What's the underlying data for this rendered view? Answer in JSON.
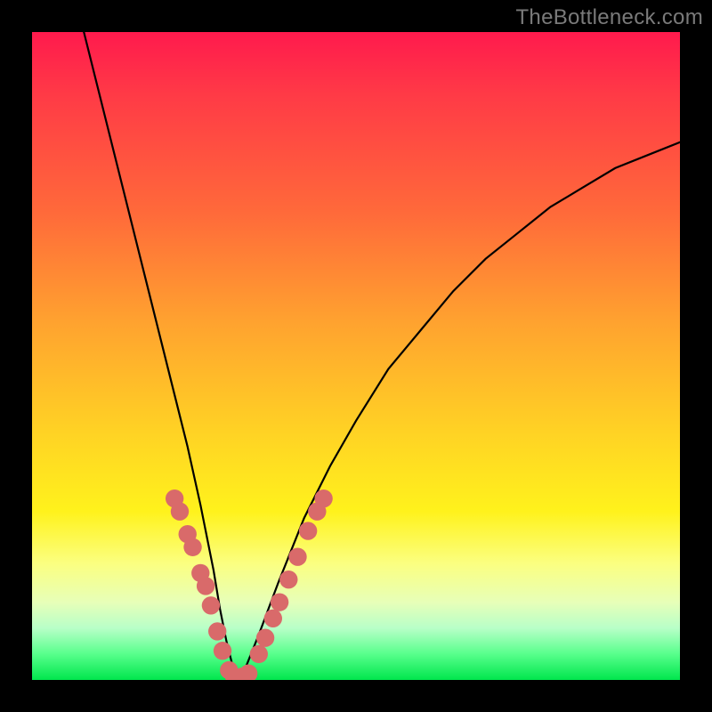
{
  "watermark": {
    "text": "TheBottleneck.com"
  },
  "chart_data": {
    "type": "line",
    "title": "",
    "xlabel": "",
    "ylabel": "",
    "xlim": [
      0,
      100
    ],
    "ylim": [
      0,
      100
    ],
    "grid": false,
    "legend": false,
    "background_gradient": {
      "direction": "vertical",
      "stops": [
        {
          "pos": 0.0,
          "color": "#ff1a4d"
        },
        {
          "pos": 0.28,
          "color": "#ff6a3a"
        },
        {
          "pos": 0.62,
          "color": "#ffd324"
        },
        {
          "pos": 0.82,
          "color": "#fbff80"
        },
        {
          "pos": 0.92,
          "color": "#b8ffc8"
        },
        {
          "pos": 1.0,
          "color": "#00e64d"
        }
      ]
    },
    "series": [
      {
        "name": "bottleneck-curve",
        "color": "#000000",
        "x": [
          8,
          10,
          12,
          14,
          16,
          18,
          20,
          22,
          24,
          26,
          28,
          29,
          30,
          31,
          32,
          33,
          35,
          38,
          42,
          46,
          50,
          55,
          60,
          65,
          70,
          75,
          80,
          85,
          90,
          95,
          100
        ],
        "y": [
          100,
          92,
          84,
          76,
          68,
          60,
          52,
          44,
          36,
          27,
          17,
          11,
          6,
          2,
          0,
          2,
          7,
          15,
          25,
          33,
          40,
          48,
          54,
          60,
          65,
          69,
          73,
          76,
          79,
          81,
          83
        ]
      }
    ],
    "markers": {
      "name": "dot-clusters",
      "color": "#d96a6a",
      "radius_pct": 1.4,
      "points": [
        {
          "x": 22.0,
          "y": 28.0
        },
        {
          "x": 22.8,
          "y": 26.0
        },
        {
          "x": 24.0,
          "y": 22.5
        },
        {
          "x": 24.8,
          "y": 20.5
        },
        {
          "x": 26.0,
          "y": 16.5
        },
        {
          "x": 26.8,
          "y": 14.5
        },
        {
          "x": 27.6,
          "y": 11.5
        },
        {
          "x": 28.6,
          "y": 7.5
        },
        {
          "x": 29.4,
          "y": 4.5
        },
        {
          "x": 30.4,
          "y": 1.5
        },
        {
          "x": 31.2,
          "y": 0.5
        },
        {
          "x": 32.4,
          "y": 0.5
        },
        {
          "x": 33.4,
          "y": 1.0
        },
        {
          "x": 35.0,
          "y": 4.0
        },
        {
          "x": 36.0,
          "y": 6.5
        },
        {
          "x": 37.2,
          "y": 9.5
        },
        {
          "x": 38.2,
          "y": 12.0
        },
        {
          "x": 39.6,
          "y": 15.5
        },
        {
          "x": 41.0,
          "y": 19.0
        },
        {
          "x": 42.6,
          "y": 23.0
        },
        {
          "x": 44.0,
          "y": 26.0
        },
        {
          "x": 45.0,
          "y": 28.0
        }
      ]
    }
  }
}
